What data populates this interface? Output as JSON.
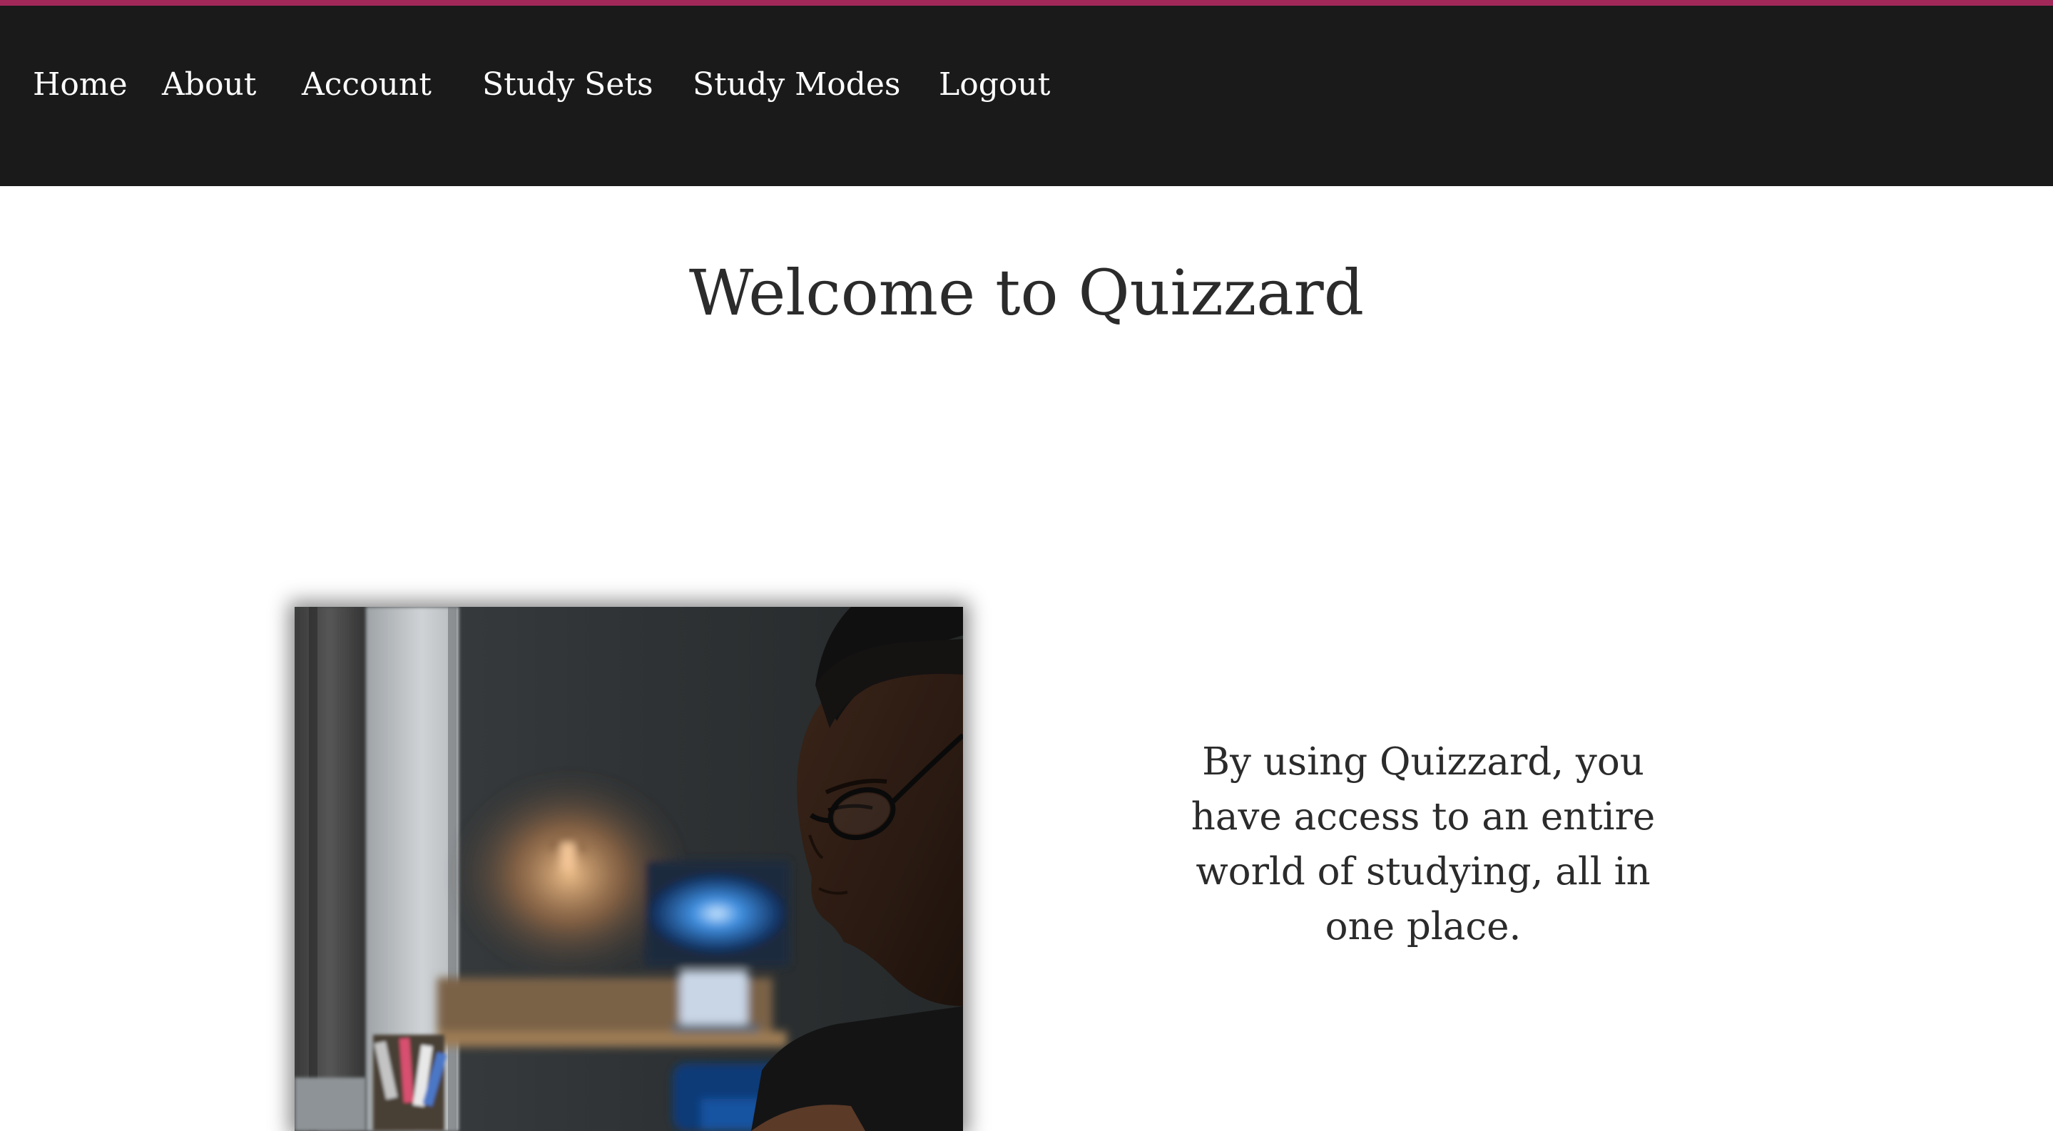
{
  "theme": {
    "accent_color": "#a3285a",
    "nav_background": "#1a1a1a",
    "nav_text_color": "#ffffff",
    "body_text_color": "#2b2b2b"
  },
  "nav": {
    "items": [
      {
        "label": "Home"
      },
      {
        "label": "About"
      },
      {
        "label": "Account"
      },
      {
        "label": "Study Sets"
      },
      {
        "label": "Study Modes"
      },
      {
        "label": "Logout"
      }
    ]
  },
  "main": {
    "title": "Welcome to Quizzard",
    "intro": "By using Quizzard, you have access to an entire world of studying, all in one place."
  }
}
